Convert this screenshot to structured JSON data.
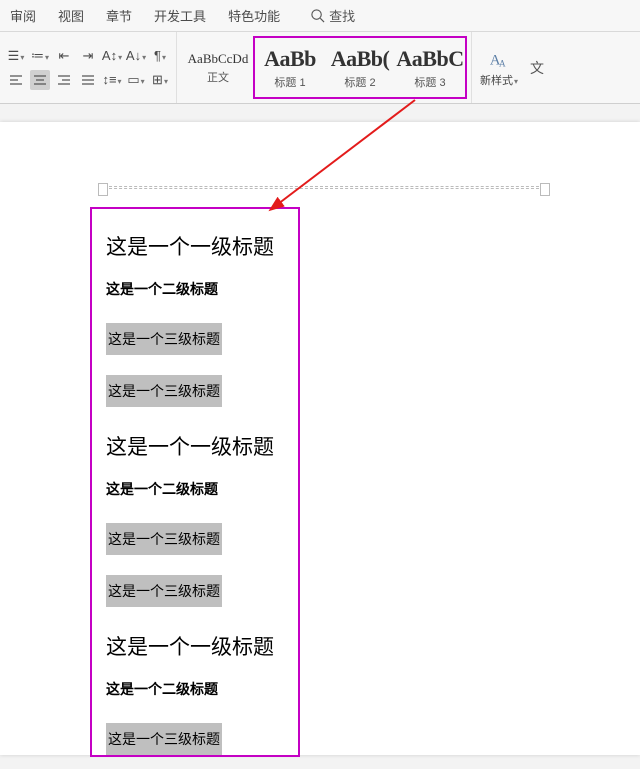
{
  "tabs": {
    "t1": "审阅",
    "t2": "视图",
    "t3": "章节",
    "t4": "开发工具",
    "t5": "特色功能",
    "search": "查找"
  },
  "styleGallery": {
    "normal": {
      "prev": "AaBbCcDd",
      "lbl": "正文"
    },
    "h1": {
      "prev": "AaBb",
      "lbl": "标题 1"
    },
    "h2": {
      "prev": "AaBb(",
      "lbl": "标题 2"
    },
    "h3": {
      "prev": "AaBbC",
      "lbl": "标题 3"
    }
  },
  "newStyle": "新样式",
  "textPaneGlyph": "文",
  "doc": {
    "l1": "这是一个一级标题",
    "l2": "这是一个二级标题",
    "l3": "这是一个三级标题"
  }
}
